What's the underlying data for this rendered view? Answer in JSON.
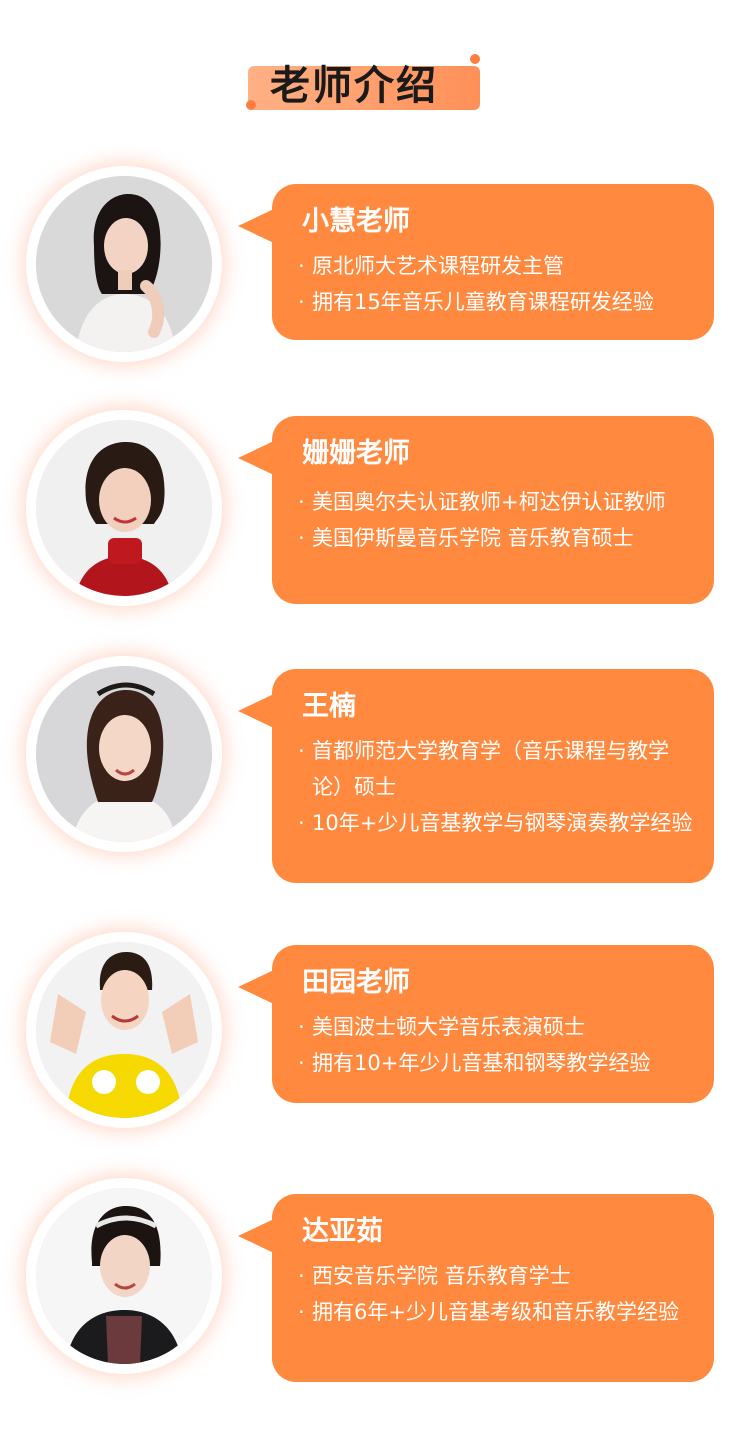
{
  "header": {
    "title": "老师介绍"
  },
  "teachers": [
    {
      "name": "小慧老师",
      "lines": [
        "原北师大艺术课程研发主管",
        "拥有15年音乐儿童教育课程研发经验"
      ]
    },
    {
      "name": "姗姗老师",
      "lines": [
        "美国奥尔夫认证教师+柯达伊认证教师",
        "美国伊斯曼音乐学院 音乐教育硕士"
      ]
    },
    {
      "name": "王楠",
      "lines": [
        "首都师范大学教育学（音乐课程与教学论）硕士",
        "10年+少儿音基教学与钢琴演奏教学经验"
      ]
    },
    {
      "name": "田园老师",
      "lines": [
        "美国波士顿大学音乐表演硕士",
        "拥有10+年少儿音基和钢琴教学经验"
      ]
    },
    {
      "name": "达亚茹",
      "lines": [
        "西安音乐学院 音乐教育学士",
        "拥有6年+少儿音基考级和音乐教学经验"
      ]
    }
  ],
  "colors": {
    "accent": "#ff8a3f",
    "header_dot": "#ff7e3d"
  }
}
